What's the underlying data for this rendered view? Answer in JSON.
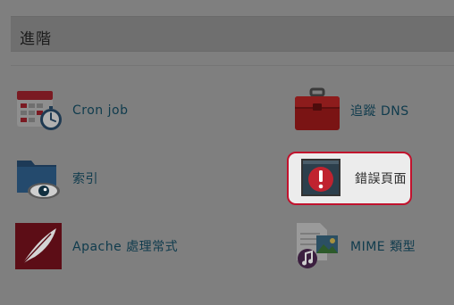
{
  "section": {
    "title": "進階"
  },
  "items": [
    {
      "label": "Cron job",
      "icon": "calendar-clock-icon"
    },
    {
      "label": "追蹤 DNS",
      "icon": "toolbox-icon"
    },
    {
      "label": "索引",
      "icon": "folder-eye-icon"
    },
    {
      "label": "錯誤頁面",
      "icon": "error-page-icon"
    },
    {
      "label": "Apache 處理常式",
      "icon": "feather-icon"
    },
    {
      "label": "MIME 類型",
      "icon": "media-files-icon"
    }
  ],
  "colors": {
    "overlay": "#7f7f7f",
    "highlight_border": "#c1122d",
    "highlight_bg": "#ececec",
    "label_text": "#0f3b4d"
  }
}
